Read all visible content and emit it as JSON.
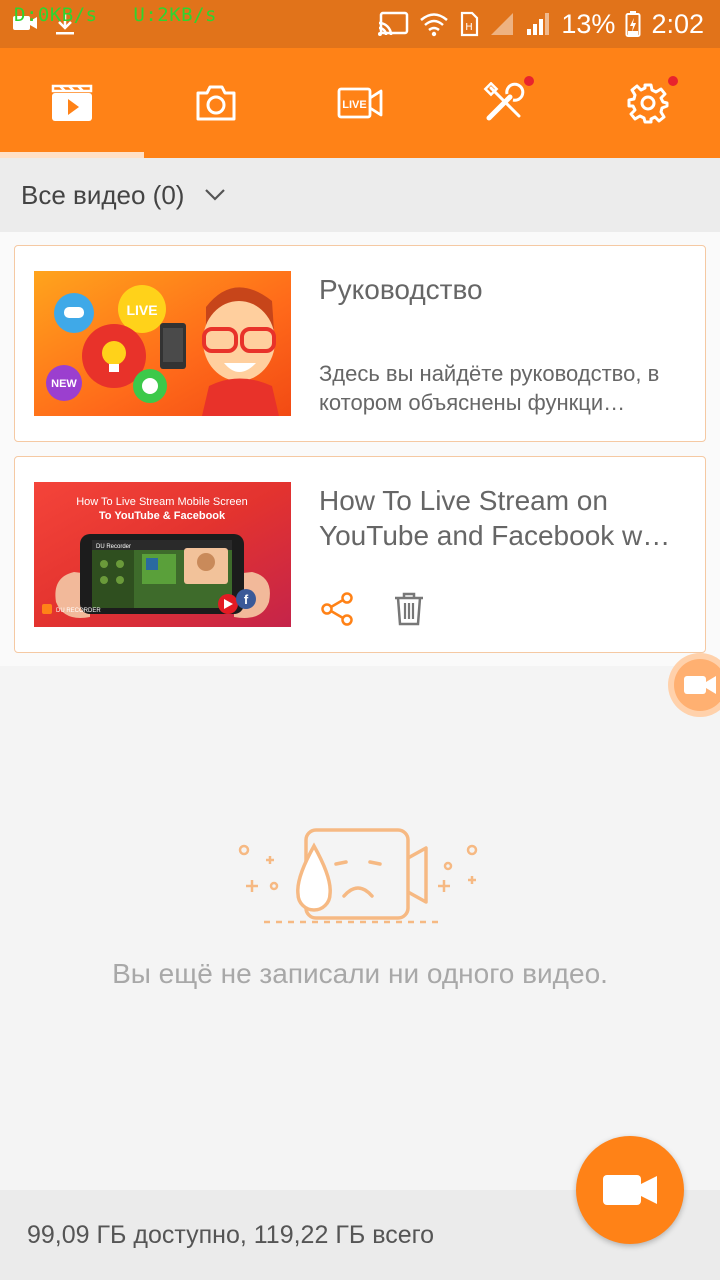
{
  "status_bar": {
    "net_speed": "D:0KB/s   U:2KB/s",
    "battery": "13%",
    "time": "2:02"
  },
  "tabs": [
    {
      "icon": "video-library-icon",
      "active": true
    },
    {
      "icon": "camera-icon",
      "active": false
    },
    {
      "icon": "live-icon",
      "label": "LIVE",
      "active": false
    },
    {
      "icon": "tools-icon",
      "active": false,
      "badge": true
    },
    {
      "icon": "gear-icon",
      "active": false,
      "badge": true
    }
  ],
  "filter": {
    "label": "Все видео (0)"
  },
  "cards": [
    {
      "title": "Руководство",
      "description": "Здесь вы найдёте руководство, в котором объяснены функци…",
      "thumb_badges": {
        "live": "LIVE",
        "new": "NEW"
      }
    },
    {
      "title": "How To Live Stream on YouTube and Facebook w…",
      "thumb_caption_1": "How To Live Stream Mobile Screen",
      "thumb_caption_2": "To YouTube & Facebook",
      "thumb_brand": "DU RECORDER",
      "thumb_screen_brand": "DU Recorder"
    }
  ],
  "empty_state": {
    "message": "Вы ещё не записали ни одного видео."
  },
  "storage": {
    "text": "99,09 ГБ доступно, 119,22 ГБ всего"
  },
  "colors": {
    "accent": "#ff8217",
    "status_bar": "#e1731a",
    "badge_red": "#e8232d"
  }
}
